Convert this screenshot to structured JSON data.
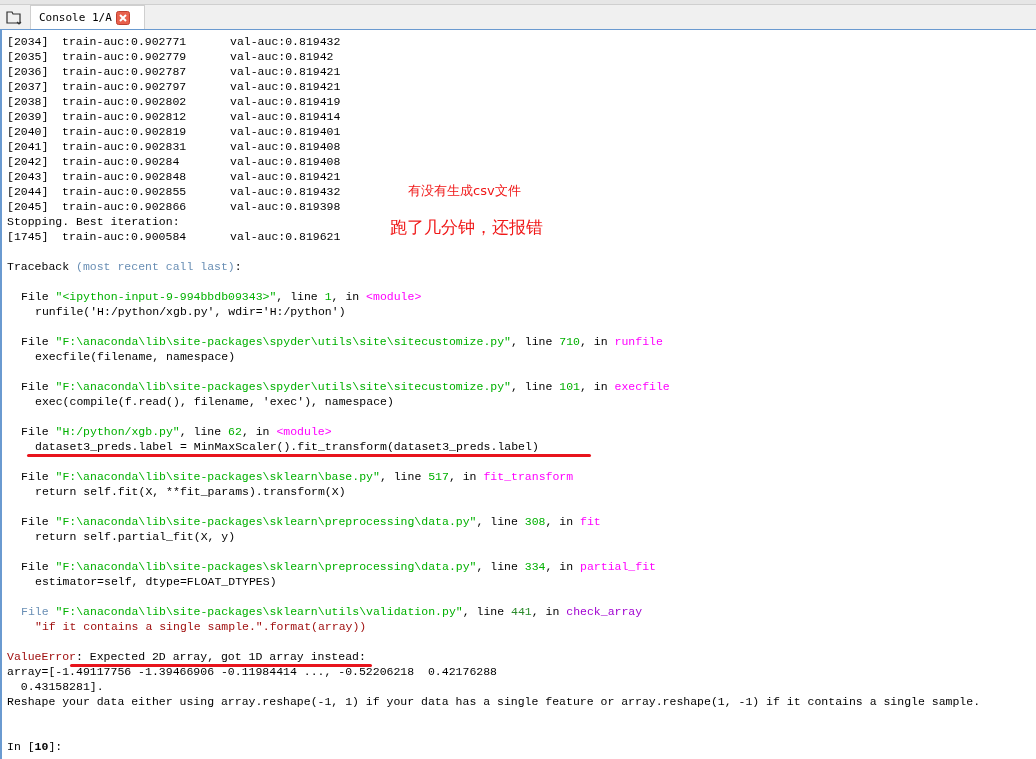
{
  "tab": {
    "label": "Console 1/A",
    "selected": true
  },
  "lines": [
    {
      "kind": "log",
      "index": "[2034]",
      "train": "train-auc:0.902771",
      "val": "val-auc:0.819432"
    },
    {
      "kind": "log",
      "index": "[2035]",
      "train": "train-auc:0.902779",
      "val": "val-auc:0.81942"
    },
    {
      "kind": "log",
      "index": "[2036]",
      "train": "train-auc:0.902787",
      "val": "val-auc:0.819421"
    },
    {
      "kind": "log",
      "index": "[2037]",
      "train": "train-auc:0.902797",
      "val": "val-auc:0.819421"
    },
    {
      "kind": "log",
      "index": "[2038]",
      "train": "train-auc:0.902802",
      "val": "val-auc:0.819419"
    },
    {
      "kind": "log",
      "index": "[2039]",
      "train": "train-auc:0.902812",
      "val": "val-auc:0.819414"
    },
    {
      "kind": "log",
      "index": "[2040]",
      "train": "train-auc:0.902819",
      "val": "val-auc:0.819401"
    },
    {
      "kind": "log",
      "index": "[2041]",
      "train": "train-auc:0.902831",
      "val": "val-auc:0.819408"
    },
    {
      "kind": "log",
      "index": "[2042]",
      "train": "train-auc:0.90284",
      "val": "val-auc:0.819408"
    },
    {
      "kind": "log",
      "index": "[2043]",
      "train": "train-auc:0.902848",
      "val": "val-auc:0.819421"
    },
    {
      "kind": "log",
      "index": "[2044]",
      "train": "train-auc:0.902855",
      "val": "val-auc:0.819432"
    },
    {
      "kind": "log",
      "index": "[2045]",
      "train": "train-auc:0.902866",
      "val": "val-auc:0.819398"
    },
    {
      "kind": "text",
      "text": "Stopping. Best iteration:"
    },
    {
      "kind": "log",
      "index": "[1745]",
      "train": "train-auc:0.900584",
      "val": "val-auc:0.819621"
    },
    {
      "kind": "blank"
    },
    {
      "kind": "traceback",
      "label": "Traceback",
      "note": "(most recent call last)",
      "end": ":"
    },
    {
      "kind": "blank"
    },
    {
      "kind": "file",
      "word": "File",
      "path": "\"<ipython-input-9-994bbdb09343>\"",
      "line_word": ", line",
      "line": "1",
      "in_word": ", in",
      "func": "<module>",
      "muted": false
    },
    {
      "kind": "code",
      "text": "runfile('H:/python/xgb.py', wdir='H:/python')"
    },
    {
      "kind": "blank"
    },
    {
      "kind": "file",
      "word": "File",
      "path": "\"F:\\anaconda\\lib\\site-packages\\spyder\\utils\\site\\sitecustomize.py\"",
      "line_word": ", line",
      "line": "710",
      "in_word": ", in",
      "func": "runfile",
      "muted": false
    },
    {
      "kind": "code",
      "text": "execfile(filename, namespace)"
    },
    {
      "kind": "blank"
    },
    {
      "kind": "file",
      "word": "File",
      "path": "\"F:\\anaconda\\lib\\site-packages\\spyder\\utils\\site\\sitecustomize.py\"",
      "line_word": ", line",
      "line": "101",
      "in_word": ", in",
      "func": "execfile",
      "muted": false
    },
    {
      "kind": "code",
      "text": "exec(compile(f.read(), filename, 'exec'), namespace)"
    },
    {
      "kind": "blank"
    },
    {
      "kind": "file",
      "word": "File",
      "path": "\"H:/python/xgb.py\"",
      "line_word": ", line",
      "line": "62",
      "in_word": ", in",
      "func": "<module>",
      "muted": false
    },
    {
      "kind": "code",
      "text": "dataset3_preds.label = MinMaxScaler().fit_transform(dataset3_preds.label)",
      "underlined": true
    },
    {
      "kind": "blank"
    },
    {
      "kind": "file",
      "word": "File",
      "path": "\"F:\\anaconda\\lib\\site-packages\\sklearn\\base.py\"",
      "line_word": ", line",
      "line": "517",
      "in_word": ", in",
      "func": "fit_transform",
      "muted": false
    },
    {
      "kind": "code",
      "text": "return self.fit(X, **fit_params).transform(X)"
    },
    {
      "kind": "blank"
    },
    {
      "kind": "file",
      "word": "File",
      "path": "\"F:\\anaconda\\lib\\site-packages\\sklearn\\preprocessing\\data.py\"",
      "line_word": ", line",
      "line": "308",
      "in_word": ", in",
      "func": "fit",
      "muted": false
    },
    {
      "kind": "code",
      "text": "return self.partial_fit(X, y)"
    },
    {
      "kind": "blank"
    },
    {
      "kind": "file",
      "word": "File",
      "path": "\"F:\\anaconda\\lib\\site-packages\\sklearn\\preprocessing\\data.py\"",
      "line_word": ", line",
      "line": "334",
      "in_word": ", in",
      "func": "partial_fit",
      "muted": false
    },
    {
      "kind": "code",
      "text": "estimator=self, dtype=FLOAT_DTYPES)"
    },
    {
      "kind": "blank"
    },
    {
      "kind": "file",
      "word": "File",
      "path": "\"F:\\anaconda\\lib\\site-packages\\sklearn\\utils\\validation.py\"",
      "line_word": ", line",
      "line": "441",
      "in_word": ", in",
      "func": "check_array",
      "muted": true
    },
    {
      "kind": "string",
      "text": "\"if it contains a single sample.\".format(array))"
    },
    {
      "kind": "blank"
    },
    {
      "kind": "error",
      "name": "ValueError",
      "message": ": Expected 2D array, got 1D array instead:",
      "underlined": true
    },
    {
      "kind": "text",
      "text": "array=[-1.49117756 -1.39466906 -0.11984414 ..., -0.52206218  0.42176288"
    },
    {
      "kind": "text",
      "text": "  0.43158281]."
    },
    {
      "kind": "text",
      "text": "Reshape your data either using array.reshape(-1, 1) if your data has a single feature or array.reshape(1, -1) if it contains a single sample."
    },
    {
      "kind": "blank"
    },
    {
      "kind": "blank"
    },
    {
      "kind": "prompt",
      "text": "In [**10**]:"
    }
  ],
  "notes": [
    "有没有生成csv文件",
    "跑了几分钟，还报错"
  ]
}
